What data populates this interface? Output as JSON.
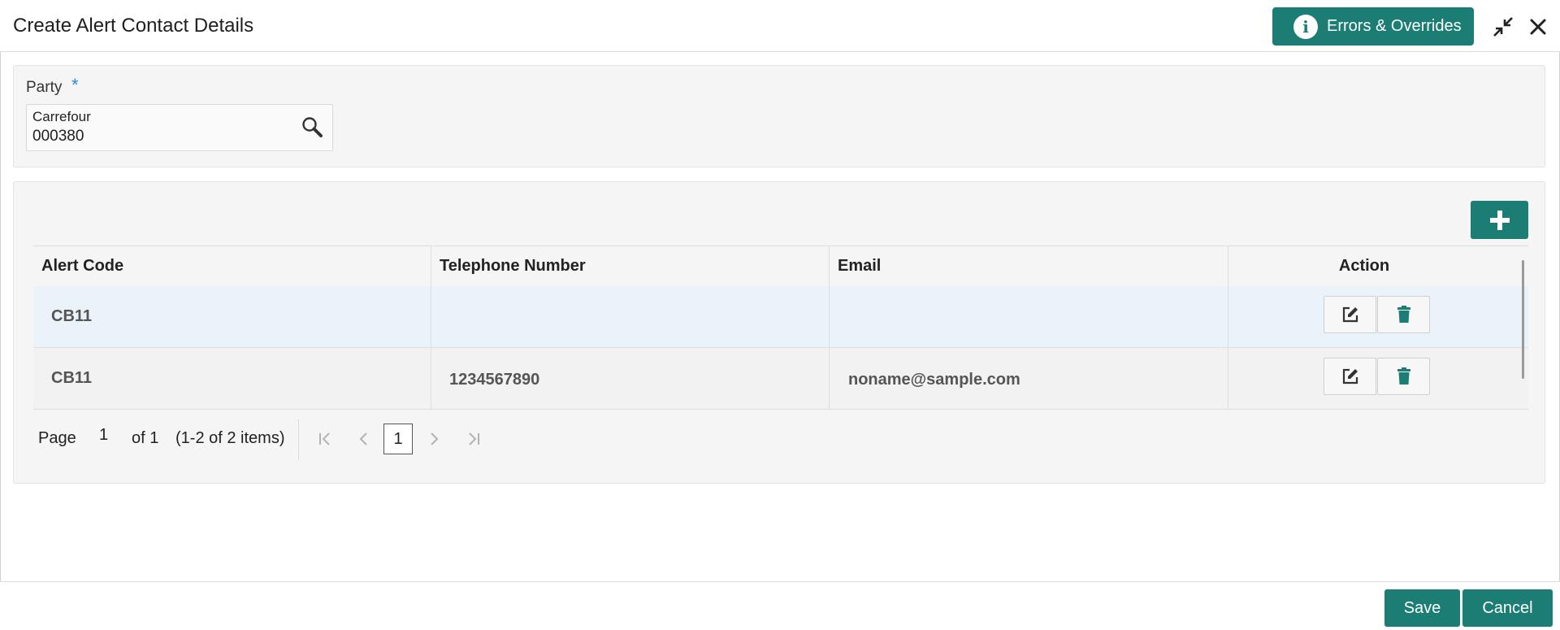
{
  "header": {
    "title": "Create Alert Contact Details",
    "errors_button": "Errors & Overrides",
    "info_glyph": "i",
    "icons": {
      "minimize": "minimize-icon",
      "close": "close-icon",
      "info": "info-icon"
    }
  },
  "party": {
    "label": "Party",
    "required_mark": "*",
    "name": "Carrefour",
    "id": "000380",
    "icon": "search-icon"
  },
  "table": {
    "columns": [
      "Alert Code",
      "Telephone Number",
      "Email",
      "Action"
    ],
    "rows": [
      {
        "alert_code": "CB11",
        "telephone": "",
        "email": ""
      },
      {
        "alert_code": "CB11",
        "telephone": "1234567890",
        "email": "noname@sample.com"
      }
    ],
    "icons": {
      "add": "plus-icon",
      "edit": "edit-icon",
      "delete": "trash-icon"
    }
  },
  "pagination": {
    "page_label": "Page",
    "page_value": "1",
    "of_label": "of 1",
    "items_label": "(1-2 of 2 items)",
    "current_page": "1"
  },
  "footer": {
    "save": "Save",
    "cancel": "Cancel"
  },
  "colors": {
    "accent": "#1b7d74",
    "required": "#2a8fc4",
    "selected_row": "#e9f3f9",
    "panel_bg": "#f5f5f5"
  }
}
